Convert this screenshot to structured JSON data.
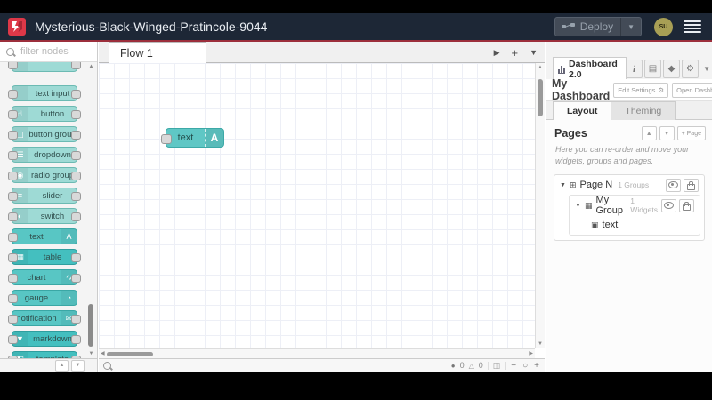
{
  "header": {
    "title": "Mysterious-Black-Winged-Pratincole-9044",
    "deploy_label": "Deploy",
    "avatar_text": "SU"
  },
  "colors": {
    "header_bg": "#1d2736",
    "brand_red": "#dd3848",
    "node_teal_light": "#9edad5",
    "node_teal": "#58c6c4",
    "node_teal_dark": "#44bfbf"
  },
  "palette": {
    "search_placeholder": "filter nodes",
    "nodes": [
      {
        "label": "",
        "icon": "",
        "shade": "light",
        "icon_side": "left",
        "ports": "both",
        "partial": "top"
      },
      {
        "label": "text input",
        "icon": "text-cursor-icon",
        "shade": "light",
        "icon_side": "left",
        "ports": "both"
      },
      {
        "label": "button",
        "icon": "pointer-icon",
        "shade": "light",
        "icon_side": "left",
        "ports": "both"
      },
      {
        "label": "button group",
        "icon": "button-group-icon",
        "shade": "light",
        "icon_side": "left",
        "ports": "both"
      },
      {
        "label": "dropdown",
        "icon": "dropdown-icon",
        "shade": "light",
        "icon_side": "left",
        "ports": "both"
      },
      {
        "label": "radio group",
        "icon": "radio-icon",
        "shade": "light",
        "icon_side": "left",
        "ports": "both"
      },
      {
        "label": "slider",
        "icon": "slider-icon",
        "shade": "light",
        "icon_side": "left",
        "ports": "both"
      },
      {
        "label": "switch",
        "icon": "switch-icon",
        "shade": "light",
        "icon_side": "left",
        "ports": "both"
      },
      {
        "label": "text",
        "icon": "text-icon",
        "shade": "medium",
        "icon_side": "right",
        "ports": "left"
      },
      {
        "label": "table",
        "icon": "table-icon",
        "shade": "dark",
        "icon_side": "left",
        "ports": "both"
      },
      {
        "label": "chart",
        "icon": "chart-icon",
        "shade": "medium",
        "icon_side": "right",
        "ports": "both"
      },
      {
        "label": "gauge",
        "icon": "gauge-icon",
        "shade": "medium",
        "icon_side": "right",
        "ports": "left"
      },
      {
        "label": "notification",
        "icon": "notification-icon",
        "shade": "medium",
        "icon_side": "right",
        "ports": "both"
      },
      {
        "label": "markdown",
        "icon": "markdown-icon",
        "shade": "dark",
        "icon_side": "left",
        "ports": "both"
      },
      {
        "label": "template",
        "icon": "template-icon",
        "shade": "dark",
        "icon_side": "left",
        "ports": "both",
        "partial": "bottom"
      }
    ]
  },
  "canvas": {
    "tab_label": "Flow 1",
    "node": {
      "label": "text",
      "icon": "text-icon"
    },
    "status": {
      "errors": "0",
      "warnings": "0"
    },
    "zoom_controls": {
      "zoom_out": "−",
      "zoom_reset": "○",
      "zoom_in": "+"
    }
  },
  "sidebar": {
    "tab_label": "Dashboard 2.0",
    "dashboard_title": "My Dashboard",
    "edit_settings_label": "Edit Settings",
    "open_dashboard_label": "Open Dashboard",
    "tabs": [
      {
        "label": "Layout"
      },
      {
        "label": "Theming"
      }
    ],
    "pages": {
      "heading": "Pages",
      "add_page_label": "+ Page",
      "help_text": "Here you can re-order and move your widgets, groups and pages.",
      "tree": [
        {
          "label": "Page N",
          "count": "1 Groups"
        },
        {
          "label": "My Group",
          "count": "1 Widgets"
        },
        {
          "label": "text",
          "count": ""
        }
      ]
    }
  }
}
